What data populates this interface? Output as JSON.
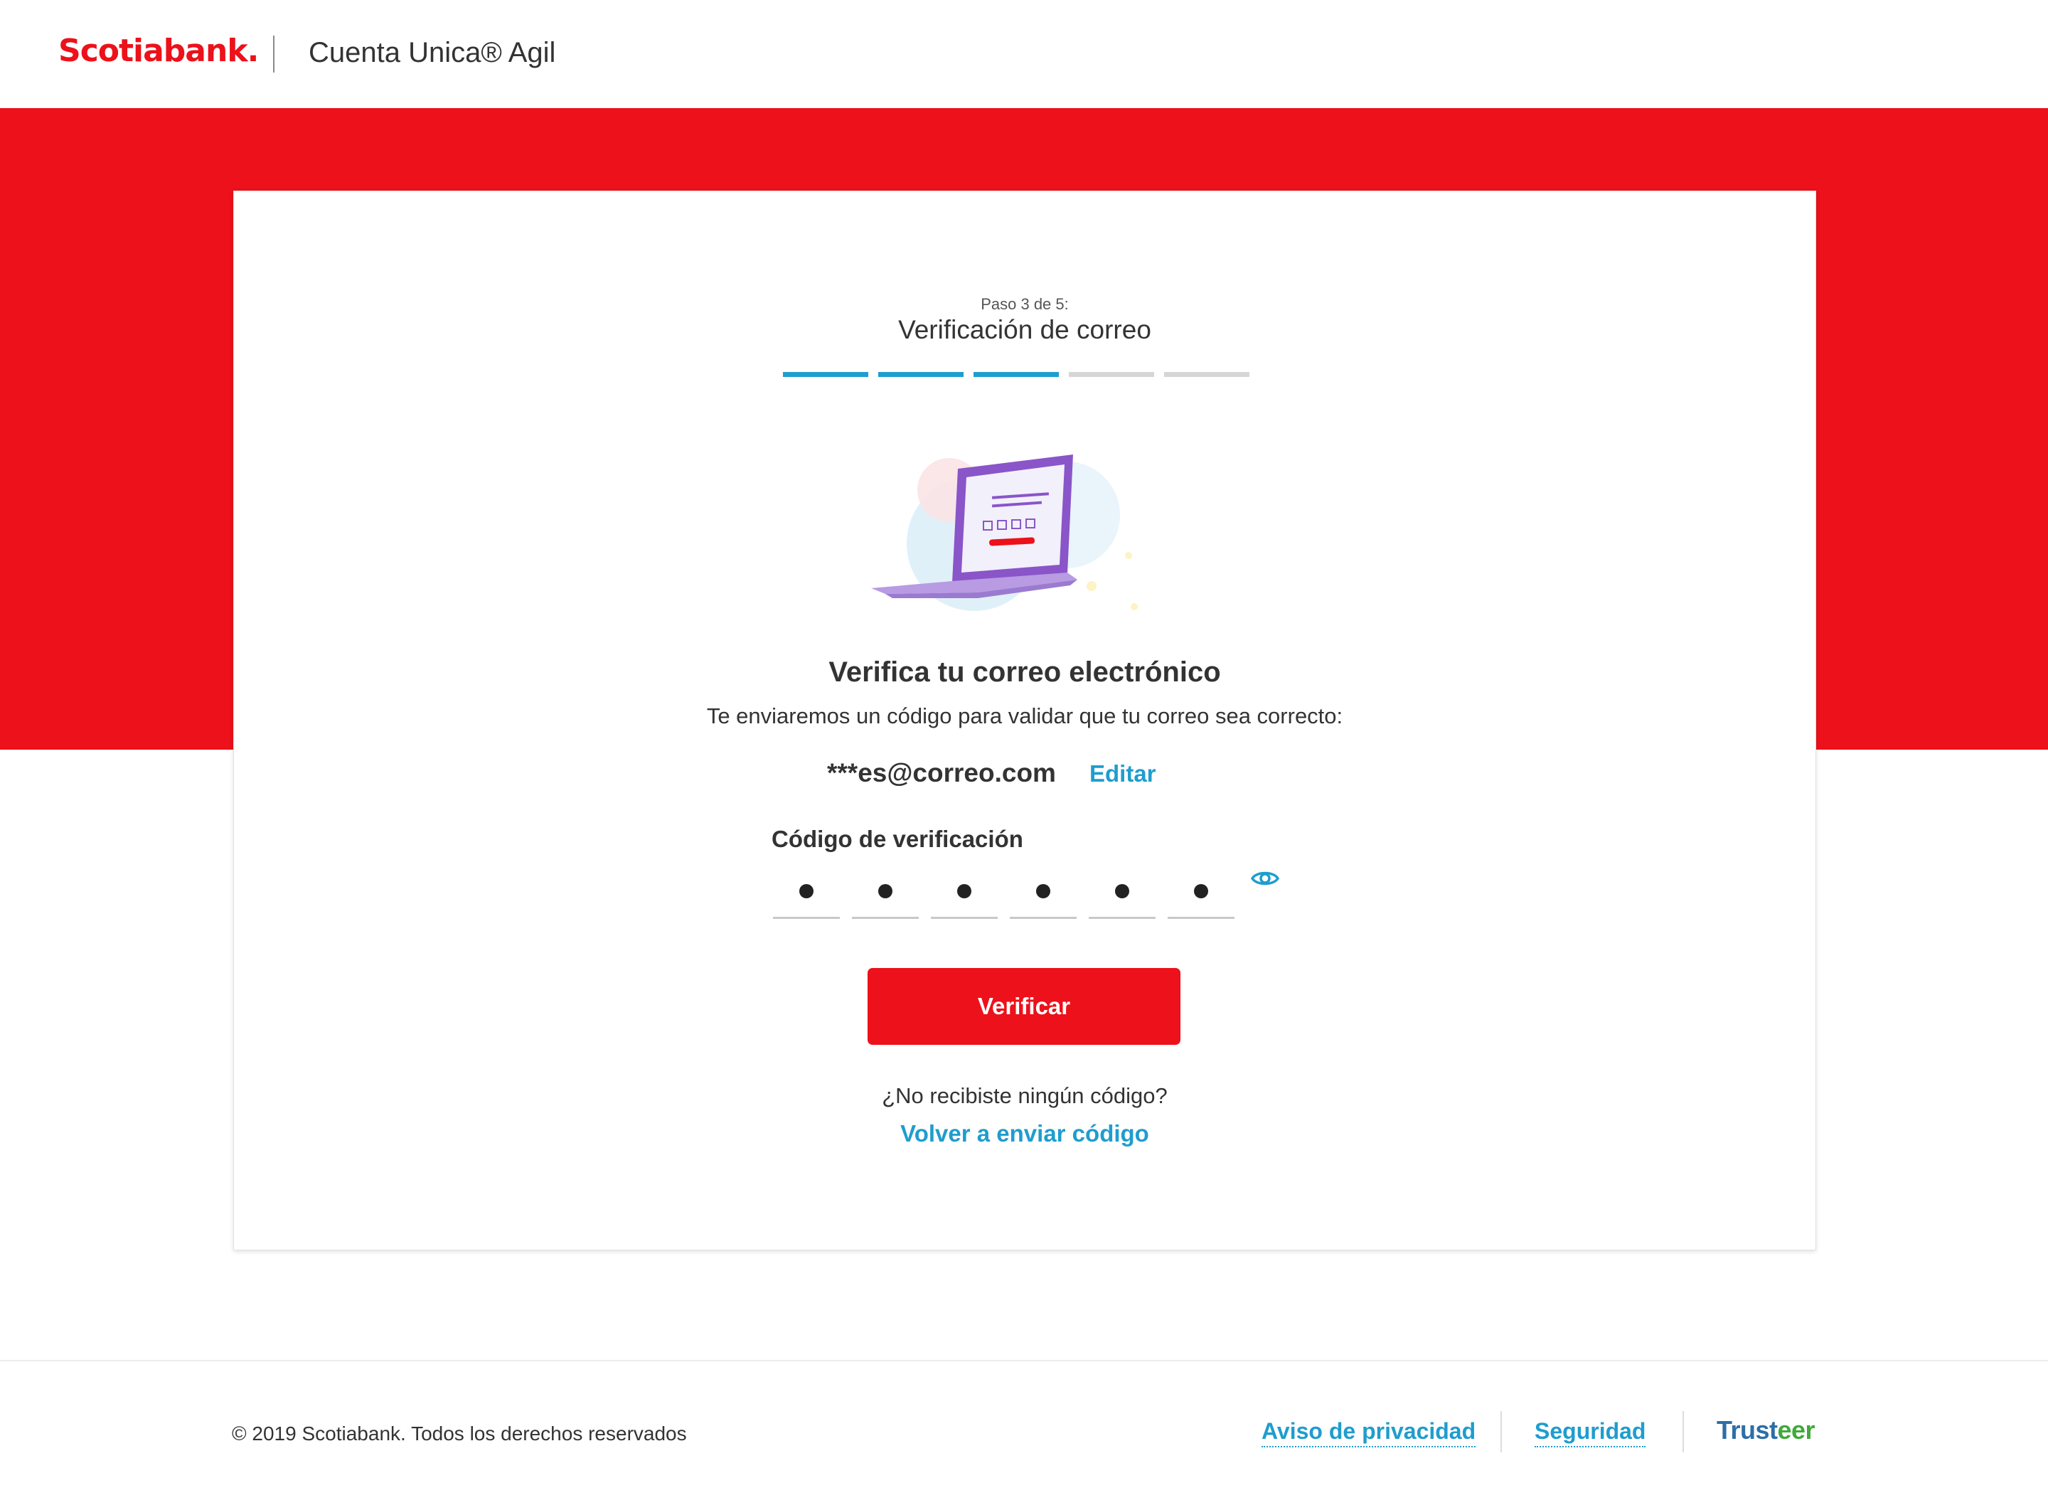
{
  "header": {
    "logo_text": "Scotiabank.",
    "product_name": "Cuenta Unica® Agil"
  },
  "stepper": {
    "step_label": "Paso 3 de 5:",
    "step_title": "Verificación de correo",
    "current_step": 3,
    "total_steps": 5
  },
  "main": {
    "headline": "Verifica tu correo electrónico",
    "subtext": "Te enviaremos un código para validar que tu correo sea correcto:",
    "email": "***es@correo.com",
    "edit_label": "Editar",
    "code_label": "Código de verificación",
    "code_digits": [
      "●",
      "●",
      "●",
      "●",
      "●",
      "●"
    ],
    "show_code_icon": "eye-icon",
    "verify_button": "Verificar",
    "no_code_text": "¿No recibiste ningún código?",
    "resend_link": "Volver a enviar código"
  },
  "footer": {
    "copyright": "© 2019 Scotiabank. Todos los derechos reservados",
    "privacy_link": "Aviso de privacidad",
    "security_link": "Seguridad",
    "trusteer_part1": "Trust",
    "trusteer_part2": "eer"
  },
  "colors": {
    "brand_red": "#ec111a",
    "link_blue": "#1f9dce",
    "progress_inactive": "#d6d6d6"
  }
}
